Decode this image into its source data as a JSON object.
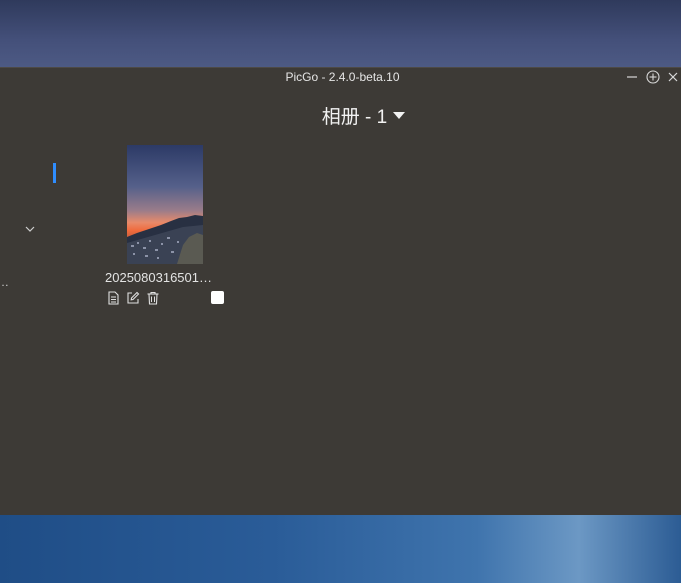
{
  "window": {
    "title": "PicGo - 2.4.0-beta.10"
  },
  "album": {
    "title": "相册 - 1"
  },
  "sidebar": {
    "fragment_text": "…"
  },
  "gallery": {
    "items": [
      {
        "file_name": "2025080316501…",
        "checked": false
      }
    ]
  },
  "colors": {
    "window_bg": "#3d3a36",
    "accent": "#2f8dff",
    "text": "#e3e3e3"
  },
  "icons": {
    "minimize": "minimize-icon",
    "maximize": "maximize-icon",
    "close": "close-icon",
    "copy": "document-icon",
    "edit": "edit-icon",
    "delete": "trash-icon",
    "dropdown": "caret-down-icon",
    "expand": "chevron-down-icon"
  }
}
